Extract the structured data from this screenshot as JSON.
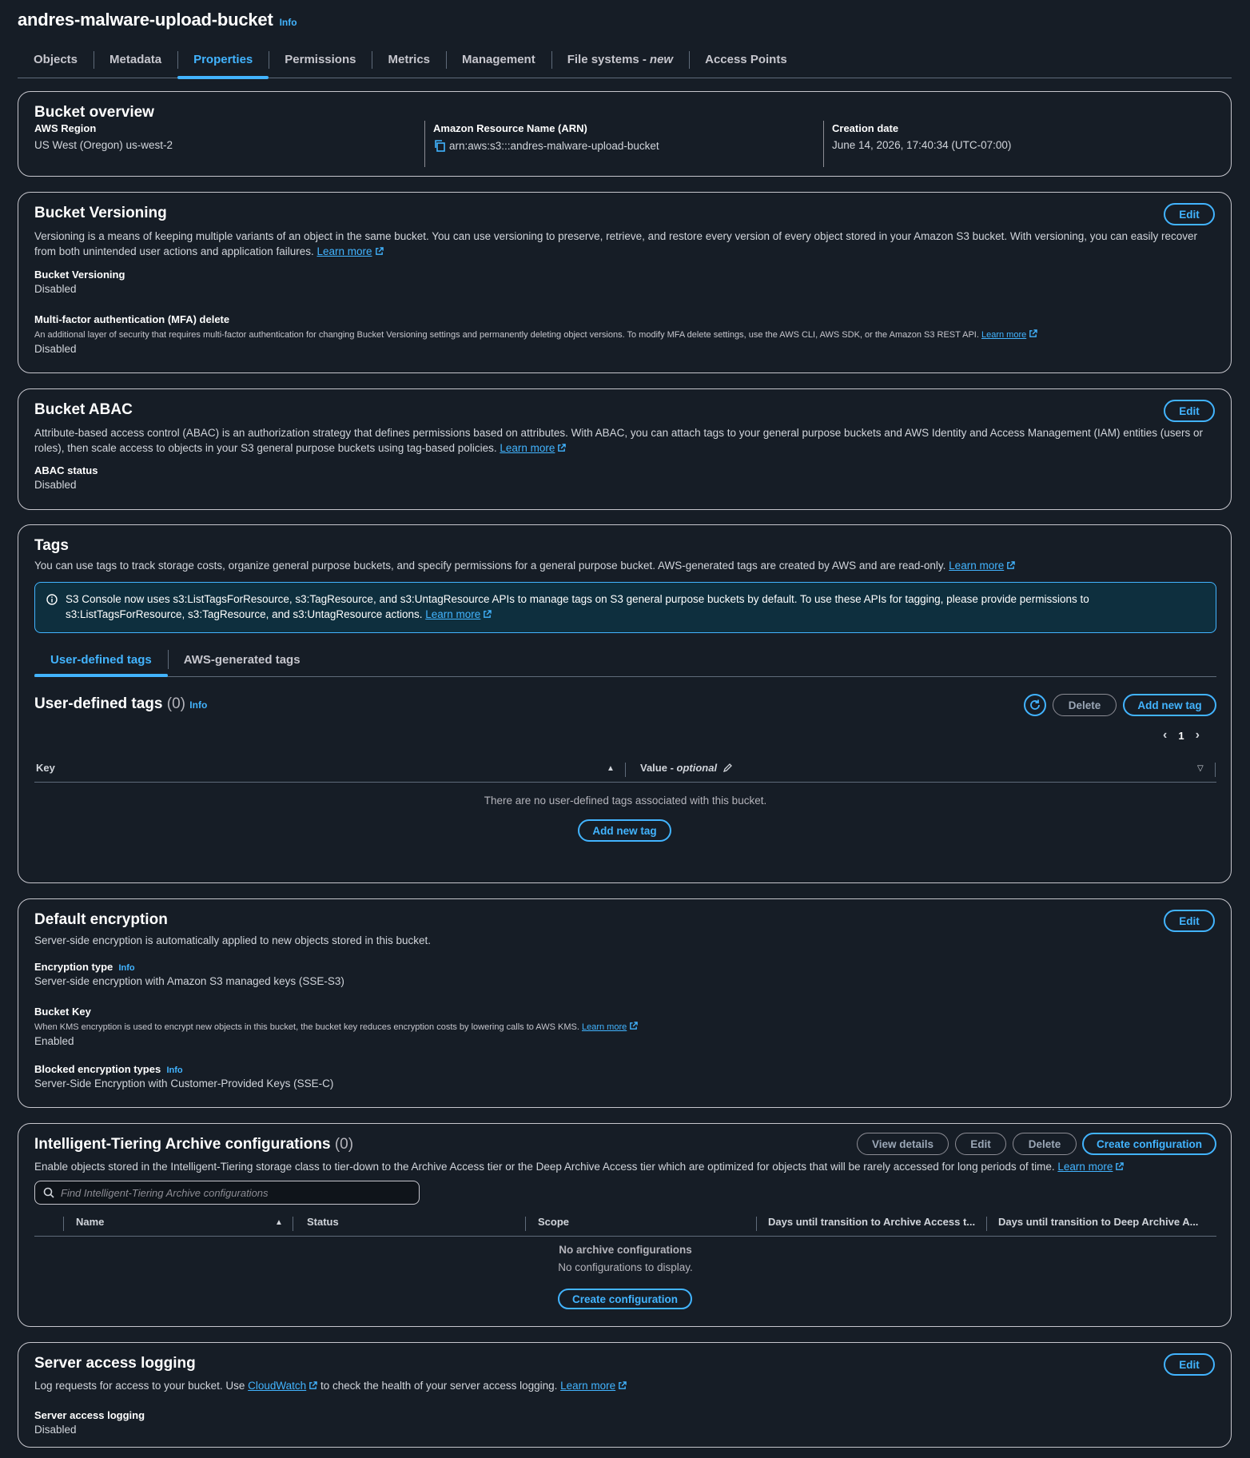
{
  "header": {
    "title": "andres-malware-upload-bucket",
    "info": "Info"
  },
  "tabs": [
    {
      "label": "Objects"
    },
    {
      "label": "Metadata"
    },
    {
      "label": "Properties"
    },
    {
      "label": "Permissions"
    },
    {
      "label": "Metrics"
    },
    {
      "label": "Management"
    },
    {
      "label": "File systems -",
      "suffix": "new"
    },
    {
      "label": "Access Points"
    }
  ],
  "overview": {
    "title": "Bucket overview",
    "region_label": "AWS Region",
    "region_value": "US West (Oregon) us-west-2",
    "arn_label": "Amazon Resource Name (ARN)",
    "arn_value": "arn:aws:s3:::andres-malware-upload-bucket",
    "created_label": "Creation date",
    "created_value": "June 14, 2026, 17:40:34 (UTC-07:00)"
  },
  "versioning": {
    "title": "Bucket Versioning",
    "edit": "Edit",
    "desc": "Versioning is a means of keeping multiple variants of an object in the same bucket. You can use versioning to preserve, retrieve, and restore every version of every object stored in your Amazon S3 bucket. With versioning, you can easily recover from both unintended user actions and application failures.",
    "learn_more": "Learn more",
    "status_label": "Bucket Versioning",
    "status_value": "Disabled",
    "mfa_label": "Multi-factor authentication (MFA) delete",
    "mfa_desc": "An additional layer of security that requires multi-factor authentication for changing Bucket Versioning settings and permanently deleting object versions. To modify MFA delete settings, use the AWS CLI, AWS SDK, or the Amazon S3 REST API.",
    "mfa_value": "Disabled"
  },
  "abac": {
    "title": "Bucket ABAC",
    "edit": "Edit",
    "desc": "Attribute-based access control (ABAC) is an authorization strategy that defines permissions based on attributes. With ABAC, you can attach tags to your general purpose buckets and AWS Identity and Access Management (IAM) entities (users or roles), then scale access to objects in your S3 general purpose buckets using tag-based policies.",
    "learn_more": "Learn more",
    "status_label": "ABAC status",
    "status_value": "Disabled"
  },
  "tags": {
    "title": "Tags",
    "desc": "You can use tags to track storage costs, organize general purpose buckets, and specify permissions for a general purpose bucket. AWS-generated tags are created by AWS and are read-only.",
    "learn_more": "Learn more",
    "alert": "S3 Console now uses s3:ListTagsForResource, s3:TagResource, and s3:UntagResource APIs to manage tags on S3 general purpose buckets by default. To use these APIs for tagging, please provide permissions to s3:ListTagsForResource, s3:TagResource, and s3:UntagResource actions.",
    "subtabs": [
      "User-defined tags",
      "AWS-generated tags"
    ],
    "table_title": "User-defined tags",
    "count": "(0)",
    "info": "Info",
    "delete": "Delete",
    "add": "Add new tag",
    "page": "1",
    "col_key": "Key",
    "col_value": "Value -",
    "col_value_suffix": "optional",
    "empty": "There are no user-defined tags associated with this bucket.",
    "empty_add": "Add new tag"
  },
  "encryption": {
    "title": "Default encryption",
    "edit": "Edit",
    "desc": "Server-side encryption is automatically applied to new objects stored in this bucket.",
    "type_label": "Encryption type",
    "info": "Info",
    "type_value": "Server-side encryption with Amazon S3 managed keys (SSE-S3)",
    "key_label": "Bucket Key",
    "key_desc": "When KMS encryption is used to encrypt new objects in this bucket, the bucket key reduces encryption costs by lowering calls to AWS KMS.",
    "learn_more": "Learn more",
    "key_value": "Enabled",
    "blocked_label": "Blocked encryption types",
    "blocked_value": "Server-Side Encryption with Customer-Provided Keys (SSE-C)"
  },
  "tiering": {
    "title": "Intelligent-Tiering Archive configurations",
    "count": "(0)",
    "view": "View details",
    "edit": "Edit",
    "delete": "Delete",
    "create": "Create configuration",
    "desc": "Enable objects stored in the Intelligent-Tiering storage class to tier-down to the Archive Access tier or the Deep Archive Access tier which are optimized for objects that will be rarely accessed for long periods of time.",
    "learn_more": "Learn more",
    "search_placeholder": "Find Intelligent-Tiering Archive configurations",
    "columns": [
      "Name",
      "Status",
      "Scope",
      "Days until transition to Archive Access t...",
      "Days until transition to Deep Archive A..."
    ],
    "empty_title": "No archive configurations",
    "empty_desc": "No configurations to display.",
    "empty_create": "Create configuration"
  },
  "logging": {
    "title": "Server access logging",
    "edit": "Edit",
    "desc_pre": "Log requests for access to your bucket. Use",
    "cloudwatch": "CloudWatch",
    "desc_post": "to check the health of your server access logging.",
    "learn_more": "Learn more",
    "status_label": "Server access logging",
    "status_value": "Disabled"
  },
  "colors": {
    "accent": "#42b4ff",
    "background": "#161d26",
    "alert_bg": "#0e2f3e"
  }
}
